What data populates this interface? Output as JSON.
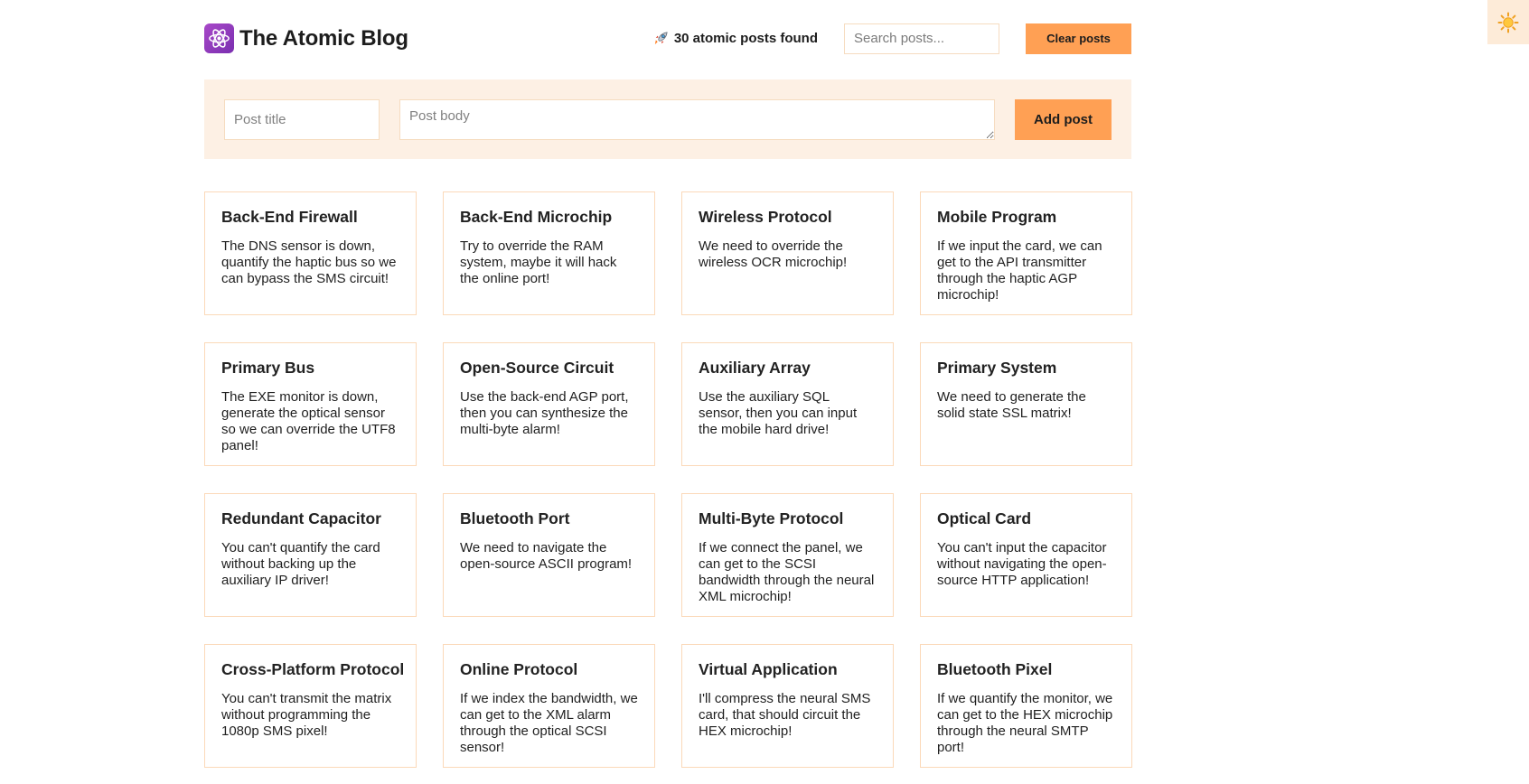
{
  "app": {
    "title": "The Atomic Blog",
    "logo_icon": "atom-icon",
    "theme_toggle_icon": "sun-icon"
  },
  "header": {
    "count_icon": "rocket-icon",
    "count_text": "30 atomic posts found",
    "search_placeholder": "Search posts...",
    "clear_label": "Clear posts"
  },
  "form": {
    "title_placeholder": "Post title",
    "body_placeholder": "Post body",
    "add_label": "Add post"
  },
  "colors": {
    "accent": "#ffa054",
    "panel_bg": "#fdf0e4",
    "card_border": "#fbd9b9",
    "logo_purple": "#9b3fc0"
  },
  "posts": [
    {
      "title": "Back-End Firewall",
      "body": "The DNS sensor is down, quantify the haptic bus so we can bypass the SMS circuit!"
    },
    {
      "title": "Back-End Microchip",
      "body": "Try to override the RAM system, maybe it will hack the online port!"
    },
    {
      "title": "Wireless Protocol",
      "body": "We need to override the wireless OCR microchip!"
    },
    {
      "title": "Mobile Program",
      "body": "If we input the card, we can get to the API transmitter through the haptic AGP microchip!"
    },
    {
      "title": "Primary Bus",
      "body": "The EXE monitor is down, generate the optical sensor so we can override the UTF8 panel!"
    },
    {
      "title": "Open-Source Circuit",
      "body": "Use the back-end AGP port, then you can synthesize the multi-byte alarm!"
    },
    {
      "title": "Auxiliary Array",
      "body": "Use the auxiliary SQL sensor, then you can input the mobile hard drive!"
    },
    {
      "title": "Primary System",
      "body": "We need to generate the solid state SSL matrix!"
    },
    {
      "title": "Redundant Capacitor",
      "body": "You can't quantify the card without backing up the auxiliary IP driver!"
    },
    {
      "title": "Bluetooth Port",
      "body": "We need to navigate the open-source ASCII program!"
    },
    {
      "title": "Multi-Byte Protocol",
      "body": "If we connect the panel, we can get to the SCSI bandwidth through the neural XML microchip!"
    },
    {
      "title": "Optical Card",
      "body": "You can't input the capacitor without navigating the open-source HTTP application!"
    },
    {
      "title": "Cross-Platform Protocol",
      "body": "You can't transmit the matrix without programming the 1080p SMS pixel!"
    },
    {
      "title": "Online Protocol",
      "body": "If we index the bandwidth, we can get to the XML alarm through the optical SCSI sensor!"
    },
    {
      "title": "Virtual Application",
      "body": "I'll compress the neural SMS card, that should circuit the HEX microchip!"
    },
    {
      "title": "Bluetooth Pixel",
      "body": "If we quantify the monitor, we can get to the HEX microchip through the neural SMTP port!"
    }
  ]
}
